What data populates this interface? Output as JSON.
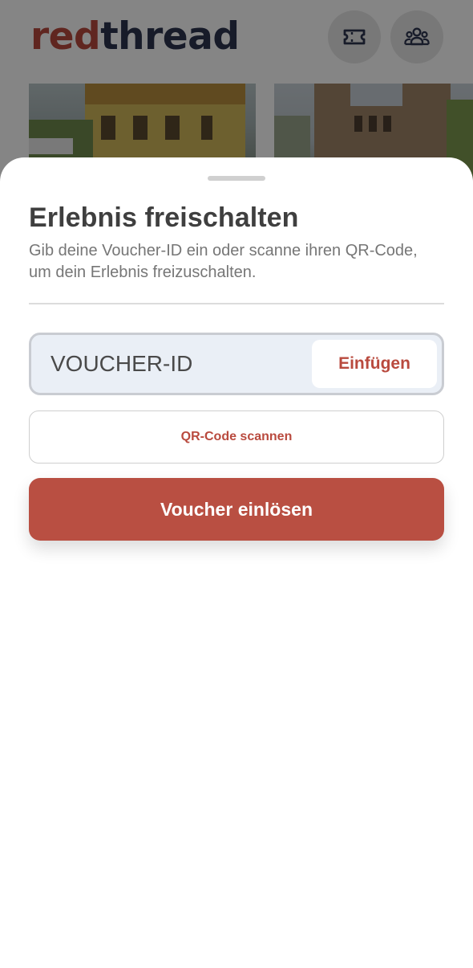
{
  "header": {
    "logo_part1": "red",
    "logo_part2": "thread",
    "ticket_icon": "ticket-icon",
    "group_icon": "group-icon"
  },
  "sheet": {
    "title": "Erlebnis freischalten",
    "description": "Gib deine Voucher-ID ein oder scanne ihren QR-Code, um dein Erlebnis freizuschalten.",
    "voucher_placeholder": "VOUCHER-ID",
    "paste_label": "Einfügen",
    "qr_label": "QR-Code scannen",
    "redeem_label": "Voucher einlösen"
  },
  "colors": {
    "brand_red": "#b94a3e",
    "brand_blue": "#2c3550"
  }
}
